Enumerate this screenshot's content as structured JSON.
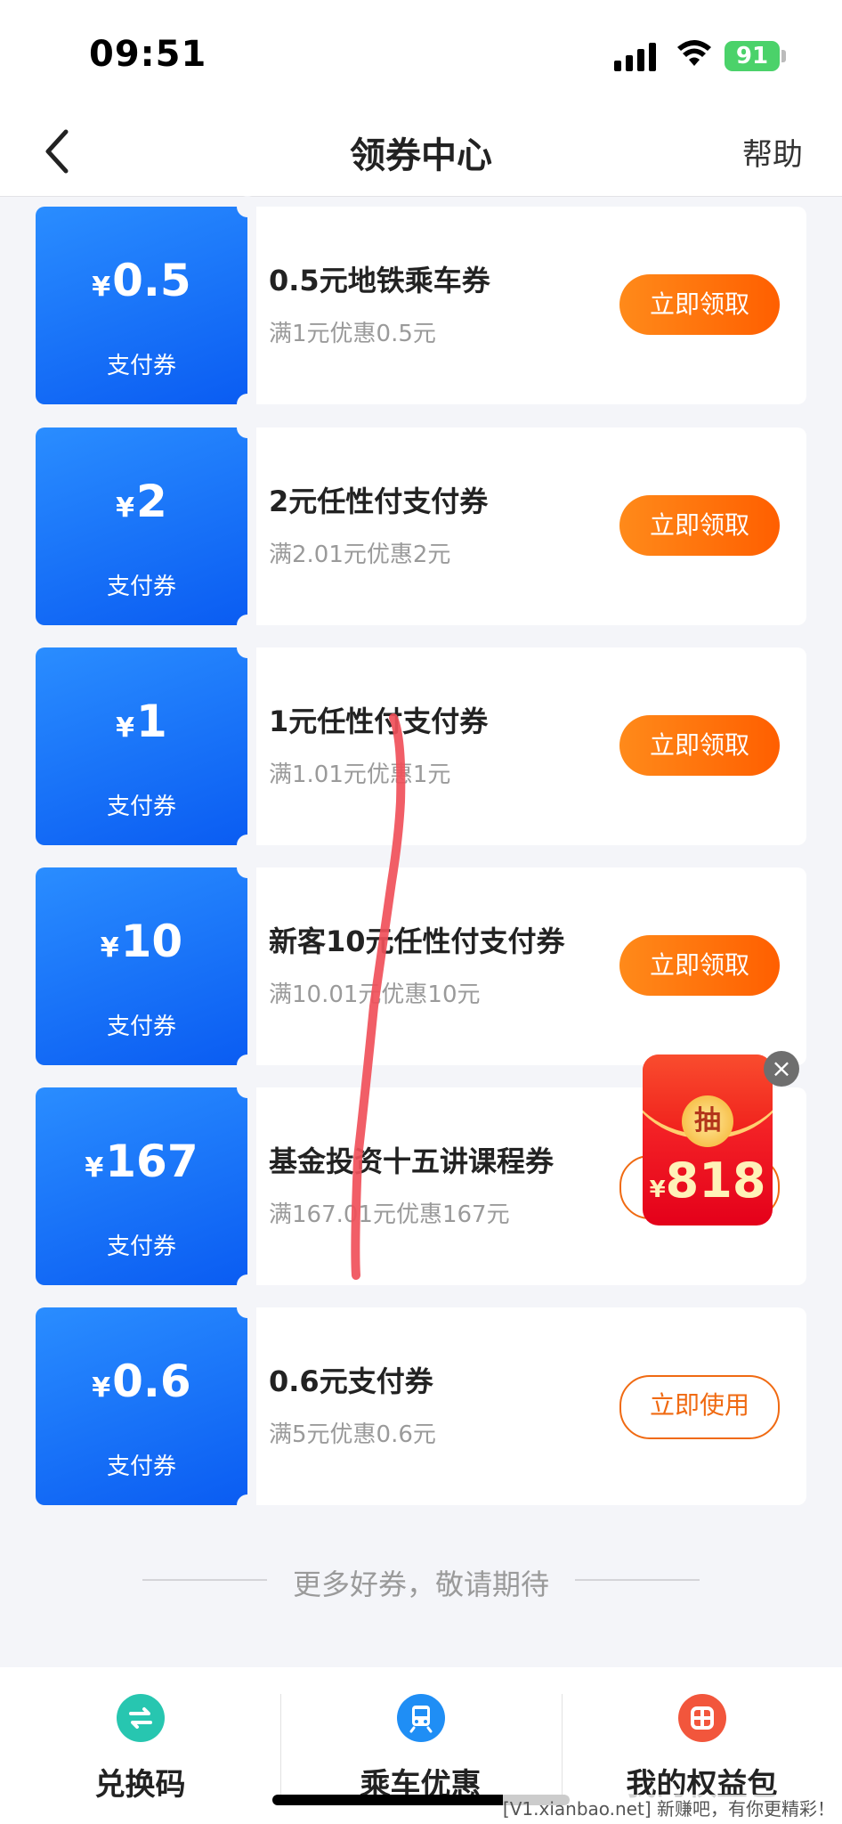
{
  "status_bar": {
    "time": "09:51",
    "battery": "91"
  },
  "nav": {
    "title": "领券中心",
    "help": "帮助"
  },
  "coupons": [
    {
      "amount": "0.5",
      "currency": "¥",
      "type": "支付券",
      "name": "0.5元地铁乘车券",
      "condition": "满1元优惠0.5元",
      "button": "立即领取"
    },
    {
      "amount": "2",
      "currency": "¥",
      "type": "支付券",
      "name": "2元任性付支付券",
      "condition": "满2.01元优惠2元",
      "button": "立即领取"
    },
    {
      "amount": "1",
      "currency": "¥",
      "type": "支付券",
      "name": "1元任性付支付券",
      "condition": "满1.01元优惠1元",
      "button": "立即领取"
    },
    {
      "amount": "10",
      "currency": "¥",
      "type": "支付券",
      "name": "新客10元任性付支付券",
      "condition": "满10.01元优惠10元",
      "button": "立即领取"
    },
    {
      "amount": "167",
      "currency": "¥",
      "type": "支付券",
      "name": "基金投资十五讲课程券",
      "condition": "满167.01元优惠167元",
      "button": ""
    },
    {
      "amount": "0.6",
      "currency": "¥",
      "type": "支付券",
      "name": "0.6元支付券",
      "condition": "满5元优惠0.6元",
      "button": "立即使用"
    }
  ],
  "more_text": "更多好券，敬请期待",
  "red_packet": {
    "coin": "抽",
    "currency": "¥",
    "amount": "818"
  },
  "tabs": [
    {
      "label": "兑换码",
      "icon": "exchange-icon",
      "color": "#27c6b0"
    },
    {
      "label": "乘车优惠",
      "icon": "train-icon",
      "color": "#1f8ef5"
    },
    {
      "label": "我的权益包",
      "icon": "gift-icon",
      "color": "#f2563c"
    }
  ],
  "watermark": "[V1.xianbao.net] 新赚吧，有你更精彩！",
  "colors": {
    "coupon_blue": "#0a5cf2",
    "button_orange": "#ff6a00"
  }
}
